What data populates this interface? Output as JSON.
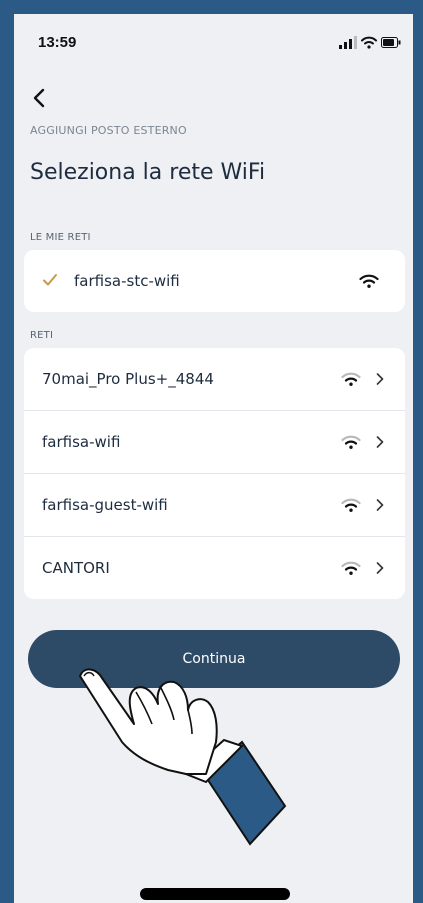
{
  "status_bar": {
    "time": "13:59"
  },
  "header": {
    "breadcrumb": "AGGIUNGI POSTO ESTERNO",
    "title": "Seleziona la rete WiFi"
  },
  "my_networks": {
    "label": "LE MIE RETI",
    "items": [
      {
        "ssid": "farfisa-stc-wifi",
        "selected": true
      }
    ]
  },
  "networks": {
    "label": "RETI",
    "items": [
      {
        "ssid": "70mai_Pro Plus+_4844"
      },
      {
        "ssid": "farfisa-wifi"
      },
      {
        "ssid": "farfisa-guest-wifi"
      },
      {
        "ssid": "CANTORI"
      }
    ]
  },
  "primary_action": {
    "label": "Continua"
  },
  "colors": {
    "frame": "#2b5a86",
    "background": "#eef0f4",
    "button": "#2d4a66",
    "check": "#c79a4a",
    "text": "#1e2c3f"
  },
  "icons": {
    "back": "chevron-left-icon",
    "check": "checkmark-icon",
    "wifi": "wifi-icon",
    "row_arrow": "chevron-right-icon",
    "overlay": "pointing-hand-icon"
  }
}
